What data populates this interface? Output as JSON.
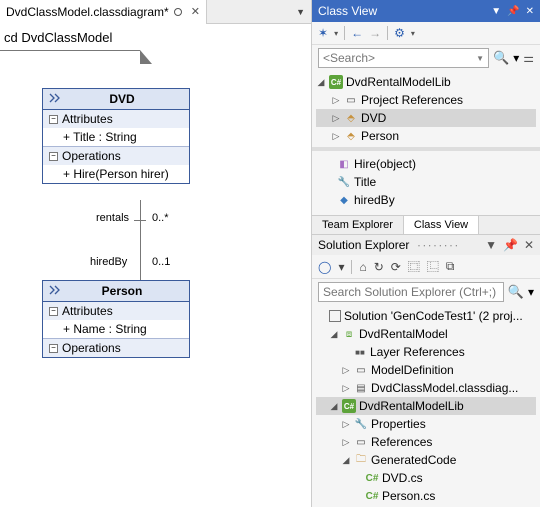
{
  "diagram": {
    "tab_label": "DvdClassModel.classdiagram*",
    "frame_label": "cd DvdClassModel",
    "dvd": {
      "name": "DVD",
      "attr_head": "Attributes",
      "attr1": "+ Title : String",
      "ops_head": "Operations",
      "op1": "+ Hire(Person hirer)"
    },
    "person": {
      "name": "Person",
      "attr_head": "Attributes",
      "attr1": "+ Name : String",
      "ops_head": "Operations"
    },
    "assoc": {
      "rentals_label": "rentals",
      "rentals_card": "0..*",
      "hiredby_label": "hiredBy",
      "hiredby_card": "0..1"
    }
  },
  "classview": {
    "title": "Class View",
    "search_placeholder": "<Search>",
    "root": "DvdRentalModelLib",
    "proj_refs": "Project References",
    "dvd": "DVD",
    "person": "Person",
    "member_hire": "Hire(object)",
    "member_title": "Title",
    "member_hiredby": "hiredBy",
    "tab_team": "Team Explorer",
    "tab_classview": "Class View"
  },
  "solution": {
    "title": "Solution Explorer",
    "search_placeholder": "Search Solution Explorer (Ctrl+;)",
    "sol": "Solution 'GenCodeTest1' (2 proj...",
    "proj_model": "DvdRentalModel",
    "layer_refs": "Layer References",
    "model_def": "ModelDefinition",
    "class_diag": "DvdClassModel.classdiag...",
    "proj_lib": "DvdRentalModelLib",
    "props": "Properties",
    "refs": "References",
    "genfolder": "GeneratedCode",
    "dvdcs": "DVD.cs",
    "personcs": "Person.cs"
  }
}
